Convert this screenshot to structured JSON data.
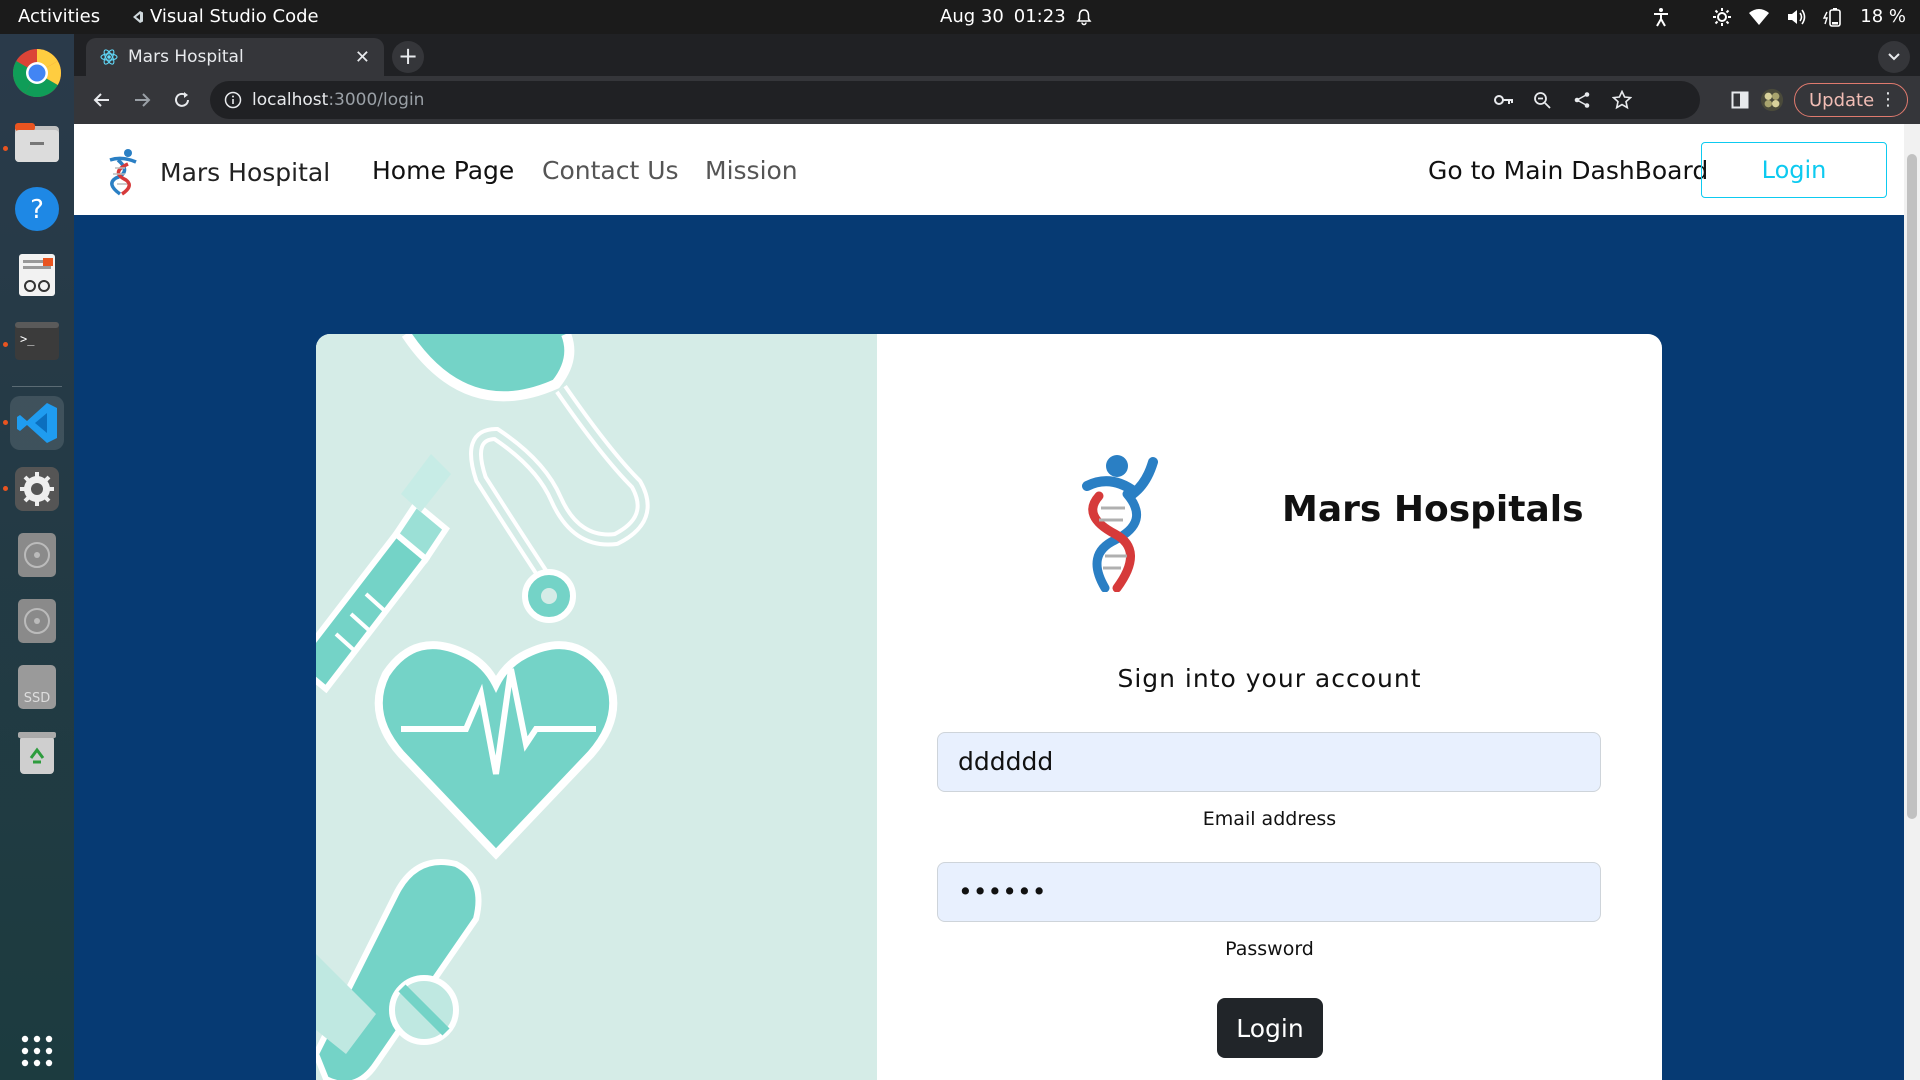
{
  "system": {
    "activities": "Activities",
    "app_name": "Visual Studio Code",
    "date": "Aug 30",
    "time": "01:23",
    "battery": "18 %"
  },
  "browser": {
    "tab_title": "Mars Hospital",
    "url_host": "localhost",
    "url_path": ":3000/login",
    "update_label": "Update"
  },
  "navbar": {
    "brand": "Mars Hospital",
    "links": [
      "Home Page",
      "Contact Us",
      "Mission"
    ],
    "dashboard_link": "Go to Main DashBoard",
    "login_label": "Login"
  },
  "form": {
    "title": "Mars Hospitals",
    "heading": "Sign into your account",
    "email_value": "dddddd",
    "email_label": "Email address",
    "password_value": "••••••",
    "password_label": "Password",
    "submit_label": "Login"
  },
  "colors": {
    "page_bg": "#063a73",
    "illustration_bg": "#d5ece7",
    "illustration_accent": "#74d3c7",
    "login_outline": "#0dcaf0"
  },
  "icons": {
    "dock": [
      "chrome-icon",
      "files-icon",
      "help-icon",
      "text-editor-icon",
      "terminal-icon",
      "vscode-icon",
      "settings-icon",
      "disc-icon",
      "disc-icon",
      "ssd-icon",
      "trash-icon",
      "app-grid-icon"
    ]
  }
}
